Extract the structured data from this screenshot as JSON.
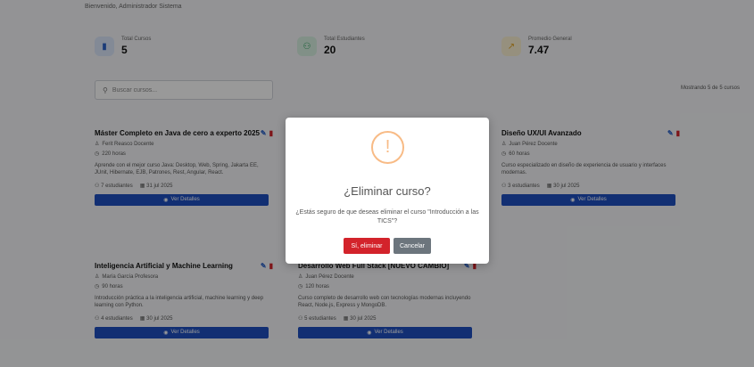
{
  "header": {
    "welcome": "Bienvenido, Administrador Sistema"
  },
  "stats": [
    {
      "label": "Total Cursos",
      "value": "5",
      "icon": "book-icon",
      "color": "#2d63c8"
    },
    {
      "label": "Total Estudiantes",
      "value": "20",
      "icon": "users-icon",
      "color": "#2a9d5c"
    },
    {
      "label": "Promedio General",
      "value": "7.47",
      "icon": "chart-icon",
      "color": "#e0a020"
    }
  ],
  "search": {
    "placeholder": "Buscar cursos..."
  },
  "showing": "Mostrando 5 de 5 cursos",
  "cards": [
    {
      "title": "Máster Completo en Java de cero a experto 2025",
      "teacher": "Ferit Reasco Docente",
      "hours": "220 horas",
      "description": "Aprende con el mejor curso Java: Desktop, Web, Spring, Jakarta EE, JUnit, Hibernate, EJB, Patrones, Rest, Angular, React.",
      "students": "7 estudiantes",
      "date": "31 jul 2025",
      "button": "Ver Detalles"
    },
    {
      "title": "Diseño UX/UI Avanzado",
      "teacher": "Juan Pérez Docente",
      "hours": "60 horas",
      "description": "Curso especializado en diseño de experiencia de usuario y interfaces modernas.",
      "students": "3 estudiantes",
      "date": "30 jul 2025",
      "button": "Ver Detalles"
    },
    {
      "title": "Inteligencia Artificial y Machine Learning",
      "teacher": "María García Profesora",
      "hours": "90 horas",
      "description": "Introducción práctica a la inteligencia artificial, machine learning y deep learning con Python.",
      "students": "4 estudiantes",
      "date": "30 jul 2025",
      "button": "Ver Detalles"
    },
    {
      "title": "Desarrollo Web Full Stack [NUEVO CAMBIO]",
      "teacher": "Juan Pérez Docente",
      "hours": "120 horas",
      "description": "Curso completo de desarrollo web con tecnologías modernas incluyendo React, Node.js, Express y MongoDB.",
      "students": "5 estudiantes",
      "date": "30 jul 2025",
      "button": "Ver Detalles"
    }
  ],
  "modal": {
    "icon": "!",
    "title": "¿Eliminar curso?",
    "text": "¿Estás seguro de que deseas eliminar el curso \"Introducción a las TICS\"?",
    "confirm": "Sí, eliminar",
    "cancel": "Cancelar"
  },
  "colors": {
    "primary": "#1f4fc0",
    "danger": "#d3232b",
    "warning": "#f8bb86",
    "secondary": "#6c757d"
  }
}
